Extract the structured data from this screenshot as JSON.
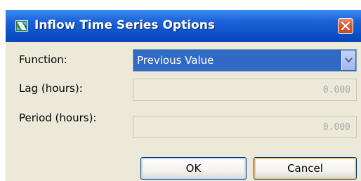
{
  "window": {
    "title": "Inflow Time Series Options",
    "app_icon": "app-icon",
    "close_icon": "close-icon"
  },
  "form": {
    "function_label": "Function:",
    "function_value": "Previous Value",
    "dropdown_icon": "chevron-down-icon",
    "lag_label": "Lag (hours):",
    "lag_value": "0.000",
    "period_label": "Period (hours):",
    "period_value": "0.000"
  },
  "buttons": {
    "ok_label": "OK",
    "cancel_label": "Cancel"
  },
  "colors": {
    "titlebar": "#0a4ec6",
    "selection": "#316ac5",
    "dialog_background": "#ece9d8",
    "close_button": "#d65a35"
  }
}
